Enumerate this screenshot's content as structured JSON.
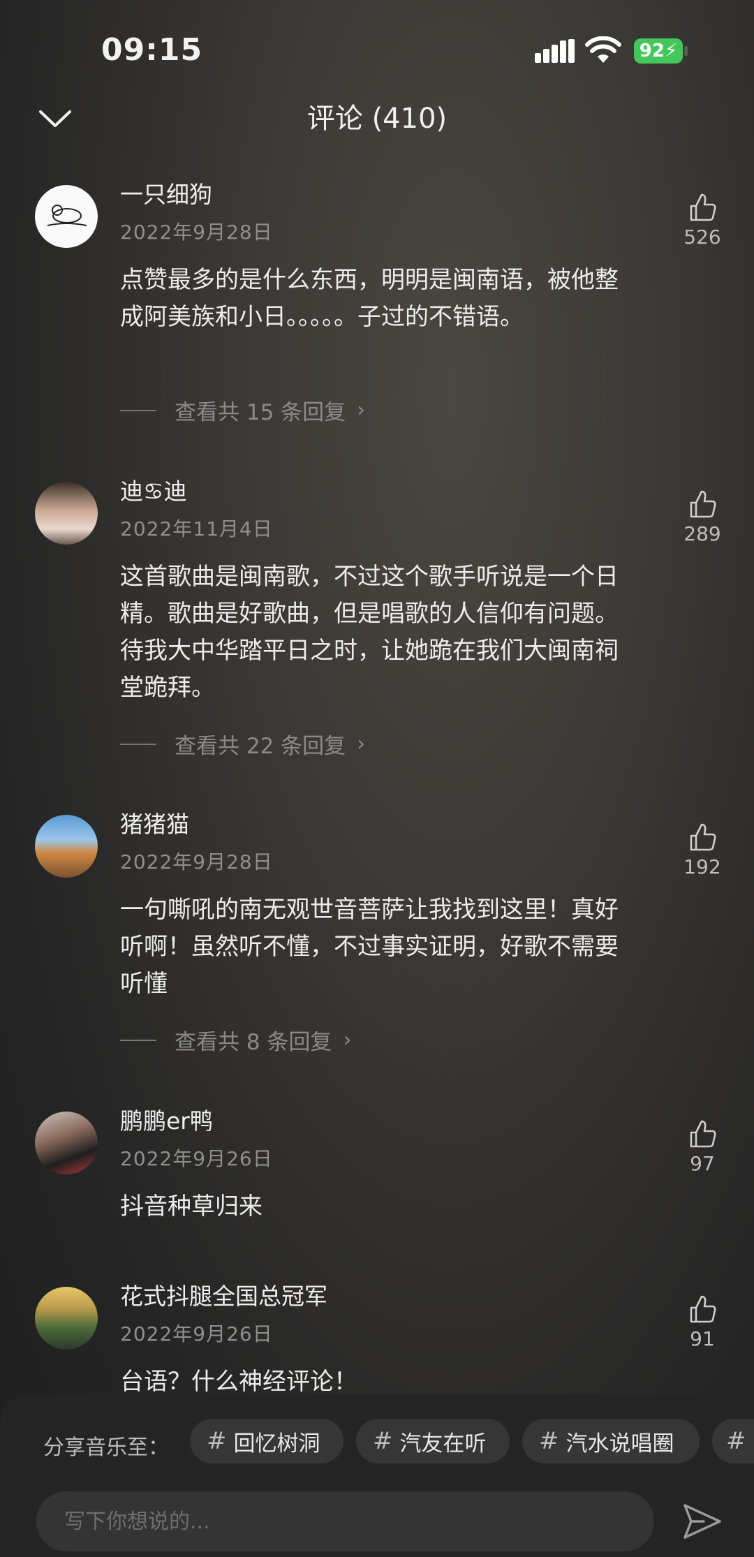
{
  "status_bar": {
    "time": "09:15",
    "battery": "92"
  },
  "header": {
    "title": "评论 (410)"
  },
  "comments": [
    {
      "username": "一只细狗",
      "date": "2022年9月28日",
      "text": "点赞最多的是什么东西，明明是闽南语，被他整成阿美族和小日。。。。。子过的不错语。",
      "replies": "查看共 15 条回复",
      "likes": "526"
    },
    {
      "username": "迪♋迪",
      "date": "2022年11月4日",
      "text": "这首歌曲是闽南歌，不过这个歌手听说是一个日精。歌曲是好歌曲，但是唱歌的人信仰有问题。待我大中华踏平日之时，让她跪在我们大闽南祠堂跪拜。",
      "replies": "查看共 22 条回复",
      "likes": "289"
    },
    {
      "username": "猪猪猫",
      "date": "2022年9月28日",
      "text": "一句嘶吼的南无观世音菩萨让我找到这里！真好听啊！虽然听不懂，不过事实证明，好歌不需要听懂",
      "replies": "查看共 8 条回复",
      "likes": "192"
    },
    {
      "username": "鹏鹏er鸭",
      "date": "2022年9月26日",
      "text": "抖音种草归来",
      "likes": "97"
    },
    {
      "username": "花式抖腿全国总冠军",
      "date": "2022年9月26日",
      "text": "台语？什么神经评论！",
      "likes": "91"
    }
  ],
  "share": {
    "label": "分享音乐至：",
    "chips": [
      "回忆树洞",
      "汽友在听",
      "汽水说唱圈"
    ]
  },
  "input": {
    "placeholder": "写下你想说的..."
  },
  "icons": {
    "back": "chevron-down-icon",
    "like": "thumbs-up-icon",
    "send": "send-icon"
  }
}
